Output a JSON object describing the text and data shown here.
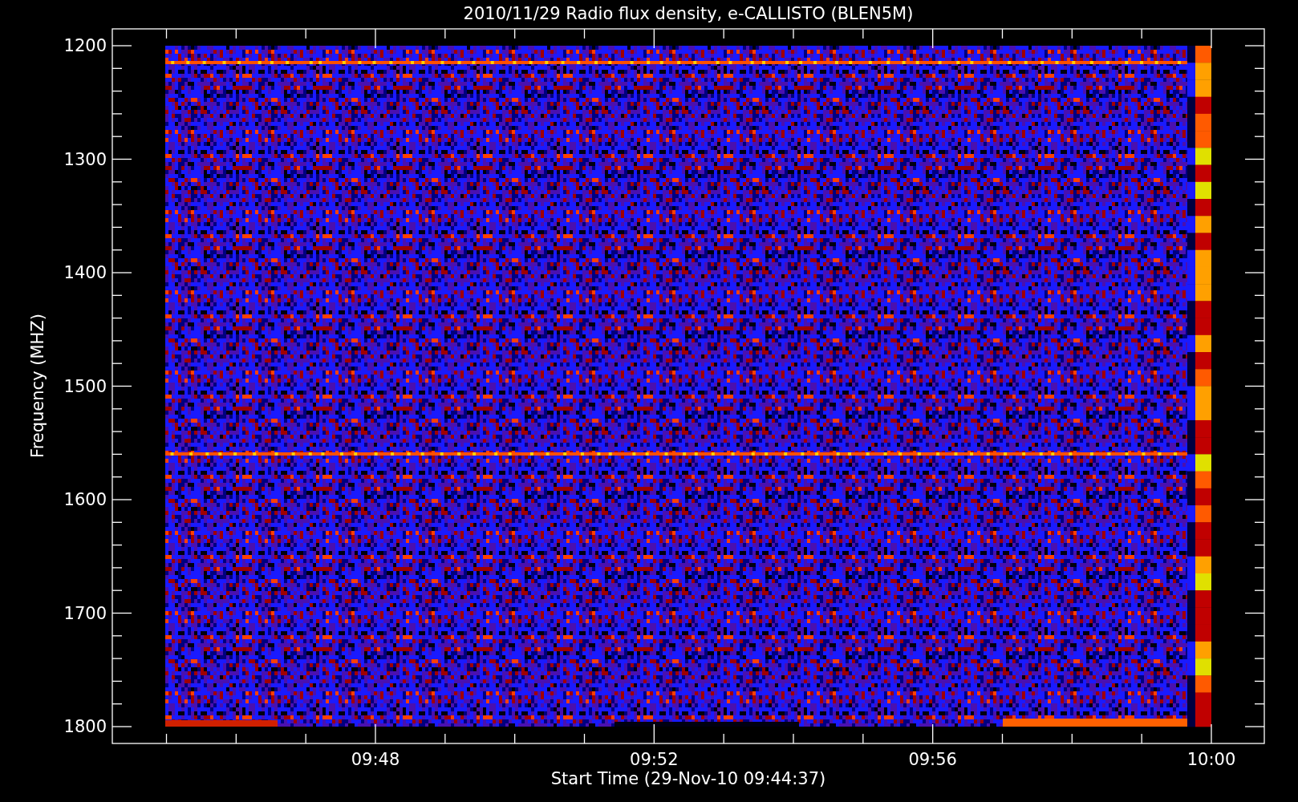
{
  "title": "2010/11/29  Radio flux density, e-CALLISTO (BLEN5M)",
  "y_axis": {
    "label": "Frequency (MHZ)",
    "ticks": [
      "1200",
      "1300",
      "1400",
      "1500",
      "1600",
      "1700",
      "1800"
    ]
  },
  "x_axis": {
    "label": "Start Time (29-Nov-10 09:44:37)",
    "ticks": [
      "09:48",
      "09:52",
      "09:56",
      "10:00"
    ]
  }
}
